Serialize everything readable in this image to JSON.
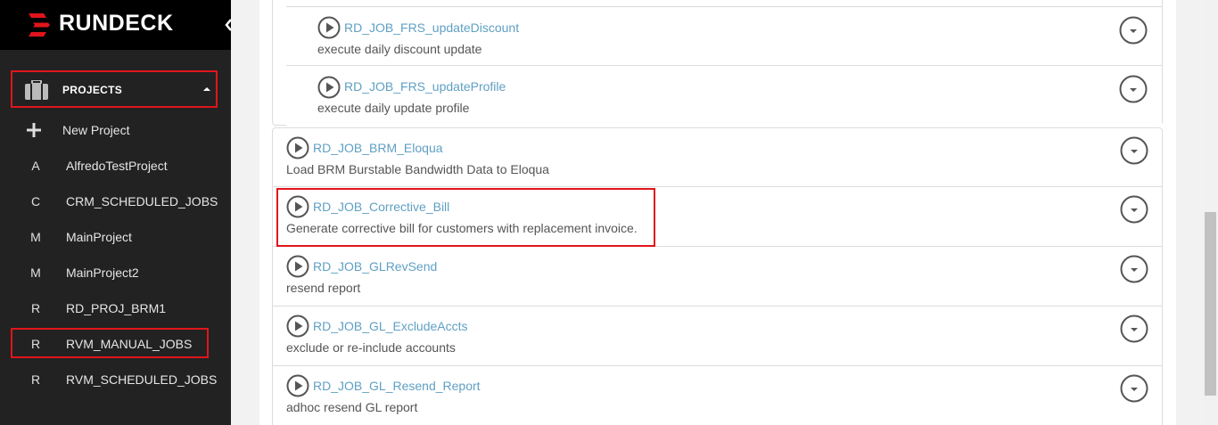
{
  "brand": {
    "name": "RUNDECK"
  },
  "sidebar": {
    "projects_label": "PROJECTS",
    "new_project_label": "New Project",
    "projects": [
      {
        "letter": "A",
        "name": "AlfredoTestProject"
      },
      {
        "letter": "C",
        "name": "CRM_SCHEDULED_JOBS"
      },
      {
        "letter": "M",
        "name": "MainProject"
      },
      {
        "letter": "M",
        "name": "MainProject2"
      },
      {
        "letter": "R",
        "name": "RD_PROJ_BRM1"
      },
      {
        "letter": "R",
        "name": "RVM_MANUAL_JOBS"
      },
      {
        "letter": "R",
        "name": "RVM_SCHEDULED_JOBS"
      }
    ]
  },
  "jobs": {
    "grouped": [
      {
        "name": "RD_JOB_FRS_updateDiscount",
        "description": "execute daily discount update"
      },
      {
        "name": "RD_JOB_FRS_updateProfile",
        "description": "execute daily update profile"
      }
    ],
    "list": [
      {
        "name": "RD_JOB_BRM_Eloqua",
        "description": "Load BRM Burstable Bandwidth Data to Eloqua"
      },
      {
        "name": "RD_JOB_Corrective_Bill",
        "description": "Generate corrective bill for customers with replacement invoice."
      },
      {
        "name": "RD_JOB_GLRevSend",
        "description": "resend report"
      },
      {
        "name": "RD_JOB_GL_ExcludeAccts",
        "description": "exclude or re-include accounts"
      },
      {
        "name": "RD_JOB_GL_Resend_Report",
        "description": "adhoc resend GL report"
      }
    ]
  },
  "colors": {
    "sidebar_bg": "#222222",
    "brand_bg": "#000000",
    "accent_red": "#e0151b",
    "link_blue": "#5fa0c4"
  },
  "icons": {
    "logo": "rundeck-logo-icon",
    "collapse": "chevron-left-icon",
    "projects": "briefcase-icon",
    "new_project": "plus-icon",
    "run_job": "play-circle-icon",
    "job_menu": "chevron-down-circle-icon"
  }
}
